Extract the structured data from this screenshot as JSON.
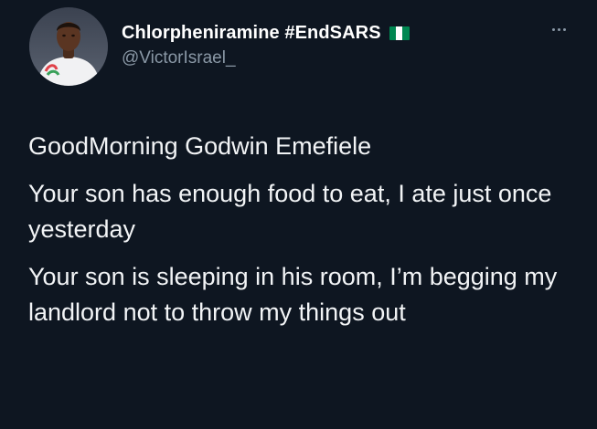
{
  "tweet": {
    "author": {
      "display_name": "Chlorpheniramine #EndSARS",
      "handle": "@VictorIsrael_",
      "flag_icon": "nigeria-flag-icon",
      "flag_colors": [
        "#008751",
        "#ffffff",
        "#008751"
      ]
    },
    "more_icon": "more-options-icon",
    "paragraphs": [
      "GoodMorning Godwin Emefiele",
      "Your son has enough food to eat, I ate just once yesterday",
      "Your son is sleeping in his room, I’m begging my landlord not to throw my things out"
    ]
  },
  "colors": {
    "background": "#0e1621",
    "text": "#f2f4f6",
    "secondary_text": "#8a98a6"
  }
}
